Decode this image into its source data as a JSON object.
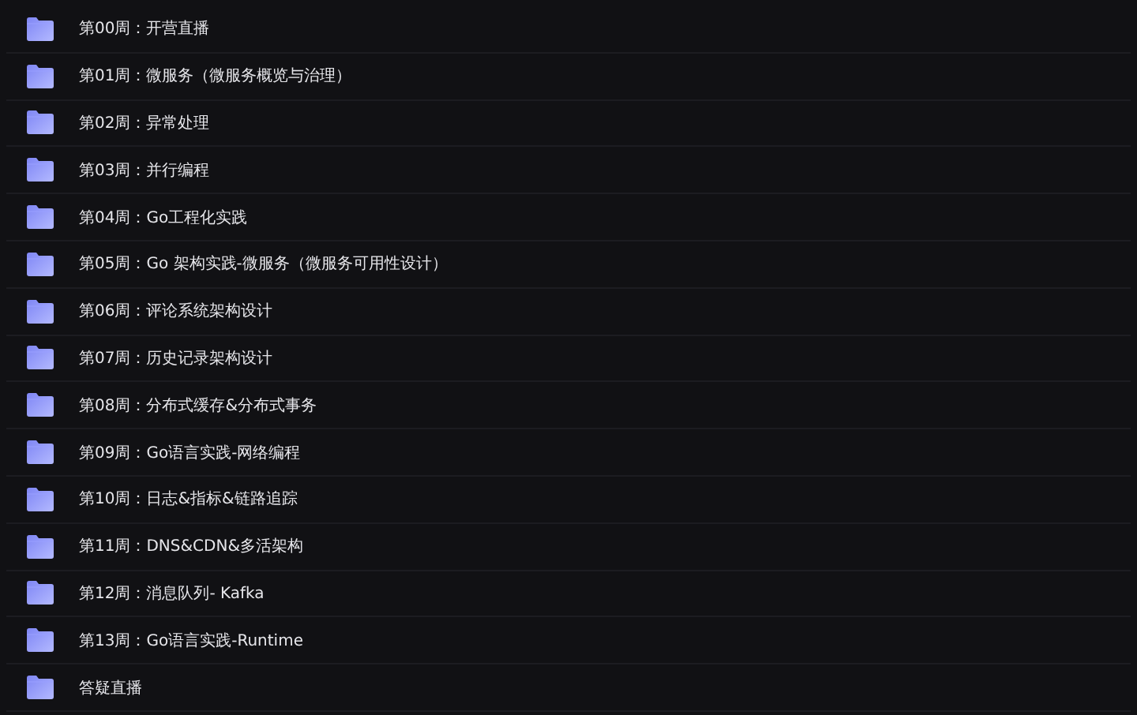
{
  "folders": [
    {
      "name": "第00周：开营直播"
    },
    {
      "name": "第01周：微服务（微服务概览与治理）"
    },
    {
      "name": "第02周：异常处理"
    },
    {
      "name": "第03周：并行编程"
    },
    {
      "name": "第04周：Go工程化实践"
    },
    {
      "name": "第05周：Go 架构实践-微服务（微服务可用性设计）"
    },
    {
      "name": "第06周：评论系统架构设计"
    },
    {
      "name": "第07周：历史记录架构设计"
    },
    {
      "name": "第08周：分布式缓存&分布式事务"
    },
    {
      "name": "第09周：Go语言实践-网络编程"
    },
    {
      "name": "第10周：日志&指标&链路追踪"
    },
    {
      "name": "第11周：DNS&CDN&多活架构"
    },
    {
      "name": "第12周：消息队列- Kafka"
    },
    {
      "name": "第13周：Go语言实践-Runtime"
    },
    {
      "name": "答疑直播"
    }
  ]
}
